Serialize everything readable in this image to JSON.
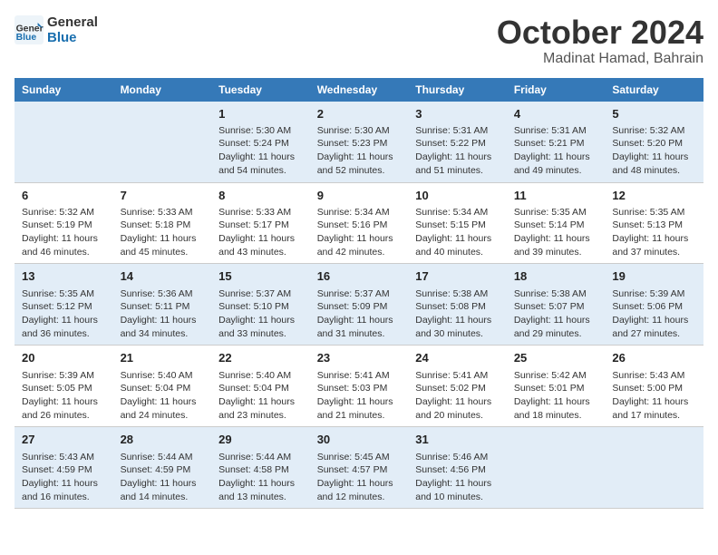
{
  "header": {
    "logo_general": "General",
    "logo_blue": "Blue",
    "month": "October 2024",
    "location": "Madinat Hamad, Bahrain"
  },
  "weekdays": [
    "Sunday",
    "Monday",
    "Tuesday",
    "Wednesday",
    "Thursday",
    "Friday",
    "Saturday"
  ],
  "weeks": [
    [
      {
        "day": "",
        "info": ""
      },
      {
        "day": "",
        "info": ""
      },
      {
        "day": "1",
        "info": "Sunrise: 5:30 AM\nSunset: 5:24 PM\nDaylight: 11 hours and 54 minutes."
      },
      {
        "day": "2",
        "info": "Sunrise: 5:30 AM\nSunset: 5:23 PM\nDaylight: 11 hours and 52 minutes."
      },
      {
        "day": "3",
        "info": "Sunrise: 5:31 AM\nSunset: 5:22 PM\nDaylight: 11 hours and 51 minutes."
      },
      {
        "day": "4",
        "info": "Sunrise: 5:31 AM\nSunset: 5:21 PM\nDaylight: 11 hours and 49 minutes."
      },
      {
        "day": "5",
        "info": "Sunrise: 5:32 AM\nSunset: 5:20 PM\nDaylight: 11 hours and 48 minutes."
      }
    ],
    [
      {
        "day": "6",
        "info": "Sunrise: 5:32 AM\nSunset: 5:19 PM\nDaylight: 11 hours and 46 minutes."
      },
      {
        "day": "7",
        "info": "Sunrise: 5:33 AM\nSunset: 5:18 PM\nDaylight: 11 hours and 45 minutes."
      },
      {
        "day": "8",
        "info": "Sunrise: 5:33 AM\nSunset: 5:17 PM\nDaylight: 11 hours and 43 minutes."
      },
      {
        "day": "9",
        "info": "Sunrise: 5:34 AM\nSunset: 5:16 PM\nDaylight: 11 hours and 42 minutes."
      },
      {
        "day": "10",
        "info": "Sunrise: 5:34 AM\nSunset: 5:15 PM\nDaylight: 11 hours and 40 minutes."
      },
      {
        "day": "11",
        "info": "Sunrise: 5:35 AM\nSunset: 5:14 PM\nDaylight: 11 hours and 39 minutes."
      },
      {
        "day": "12",
        "info": "Sunrise: 5:35 AM\nSunset: 5:13 PM\nDaylight: 11 hours and 37 minutes."
      }
    ],
    [
      {
        "day": "13",
        "info": "Sunrise: 5:35 AM\nSunset: 5:12 PM\nDaylight: 11 hours and 36 minutes."
      },
      {
        "day": "14",
        "info": "Sunrise: 5:36 AM\nSunset: 5:11 PM\nDaylight: 11 hours and 34 minutes."
      },
      {
        "day": "15",
        "info": "Sunrise: 5:37 AM\nSunset: 5:10 PM\nDaylight: 11 hours and 33 minutes."
      },
      {
        "day": "16",
        "info": "Sunrise: 5:37 AM\nSunset: 5:09 PM\nDaylight: 11 hours and 31 minutes."
      },
      {
        "day": "17",
        "info": "Sunrise: 5:38 AM\nSunset: 5:08 PM\nDaylight: 11 hours and 30 minutes."
      },
      {
        "day": "18",
        "info": "Sunrise: 5:38 AM\nSunset: 5:07 PM\nDaylight: 11 hours and 29 minutes."
      },
      {
        "day": "19",
        "info": "Sunrise: 5:39 AM\nSunset: 5:06 PM\nDaylight: 11 hours and 27 minutes."
      }
    ],
    [
      {
        "day": "20",
        "info": "Sunrise: 5:39 AM\nSunset: 5:05 PM\nDaylight: 11 hours and 26 minutes."
      },
      {
        "day": "21",
        "info": "Sunrise: 5:40 AM\nSunset: 5:04 PM\nDaylight: 11 hours and 24 minutes."
      },
      {
        "day": "22",
        "info": "Sunrise: 5:40 AM\nSunset: 5:04 PM\nDaylight: 11 hours and 23 minutes."
      },
      {
        "day": "23",
        "info": "Sunrise: 5:41 AM\nSunset: 5:03 PM\nDaylight: 11 hours and 21 minutes."
      },
      {
        "day": "24",
        "info": "Sunrise: 5:41 AM\nSunset: 5:02 PM\nDaylight: 11 hours and 20 minutes."
      },
      {
        "day": "25",
        "info": "Sunrise: 5:42 AM\nSunset: 5:01 PM\nDaylight: 11 hours and 18 minutes."
      },
      {
        "day": "26",
        "info": "Sunrise: 5:43 AM\nSunset: 5:00 PM\nDaylight: 11 hours and 17 minutes."
      }
    ],
    [
      {
        "day": "27",
        "info": "Sunrise: 5:43 AM\nSunset: 4:59 PM\nDaylight: 11 hours and 16 minutes."
      },
      {
        "day": "28",
        "info": "Sunrise: 5:44 AM\nSunset: 4:59 PM\nDaylight: 11 hours and 14 minutes."
      },
      {
        "day": "29",
        "info": "Sunrise: 5:44 AM\nSunset: 4:58 PM\nDaylight: 11 hours and 13 minutes."
      },
      {
        "day": "30",
        "info": "Sunrise: 5:45 AM\nSunset: 4:57 PM\nDaylight: 11 hours and 12 minutes."
      },
      {
        "day": "31",
        "info": "Sunrise: 5:46 AM\nSunset: 4:56 PM\nDaylight: 11 hours and 10 minutes."
      },
      {
        "day": "",
        "info": ""
      },
      {
        "day": "",
        "info": ""
      }
    ]
  ]
}
